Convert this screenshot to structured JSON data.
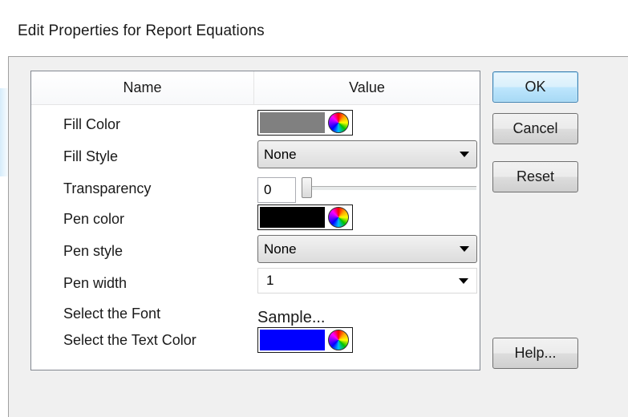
{
  "window": {
    "title": "Edit Properties for Report Equations"
  },
  "grid": {
    "headers": {
      "name": "Name",
      "value": "Value"
    },
    "rows": {
      "fill_color": {
        "label": "Fill Color",
        "color": "#808080"
      },
      "fill_style": {
        "label": "Fill Style",
        "value": "None"
      },
      "transparency": {
        "label": "Transparency",
        "value": "0",
        "level": 0
      },
      "pen_color": {
        "label": "Pen color",
        "color": "#000000"
      },
      "pen_style": {
        "label": "Pen style",
        "value": "None"
      },
      "pen_width": {
        "label": "Pen width",
        "value": "1"
      },
      "font": {
        "label": "Select the Font",
        "sample": "Sample..."
      },
      "text_color": {
        "label": "Select the Text Color",
        "color": "#0000ff"
      }
    }
  },
  "buttons": {
    "ok": "OK",
    "cancel": "Cancel",
    "reset": "Reset",
    "help": "Help..."
  },
  "icons": {
    "color_picker": "color-wheel-icon",
    "dropdown": "chevron-down-icon"
  }
}
